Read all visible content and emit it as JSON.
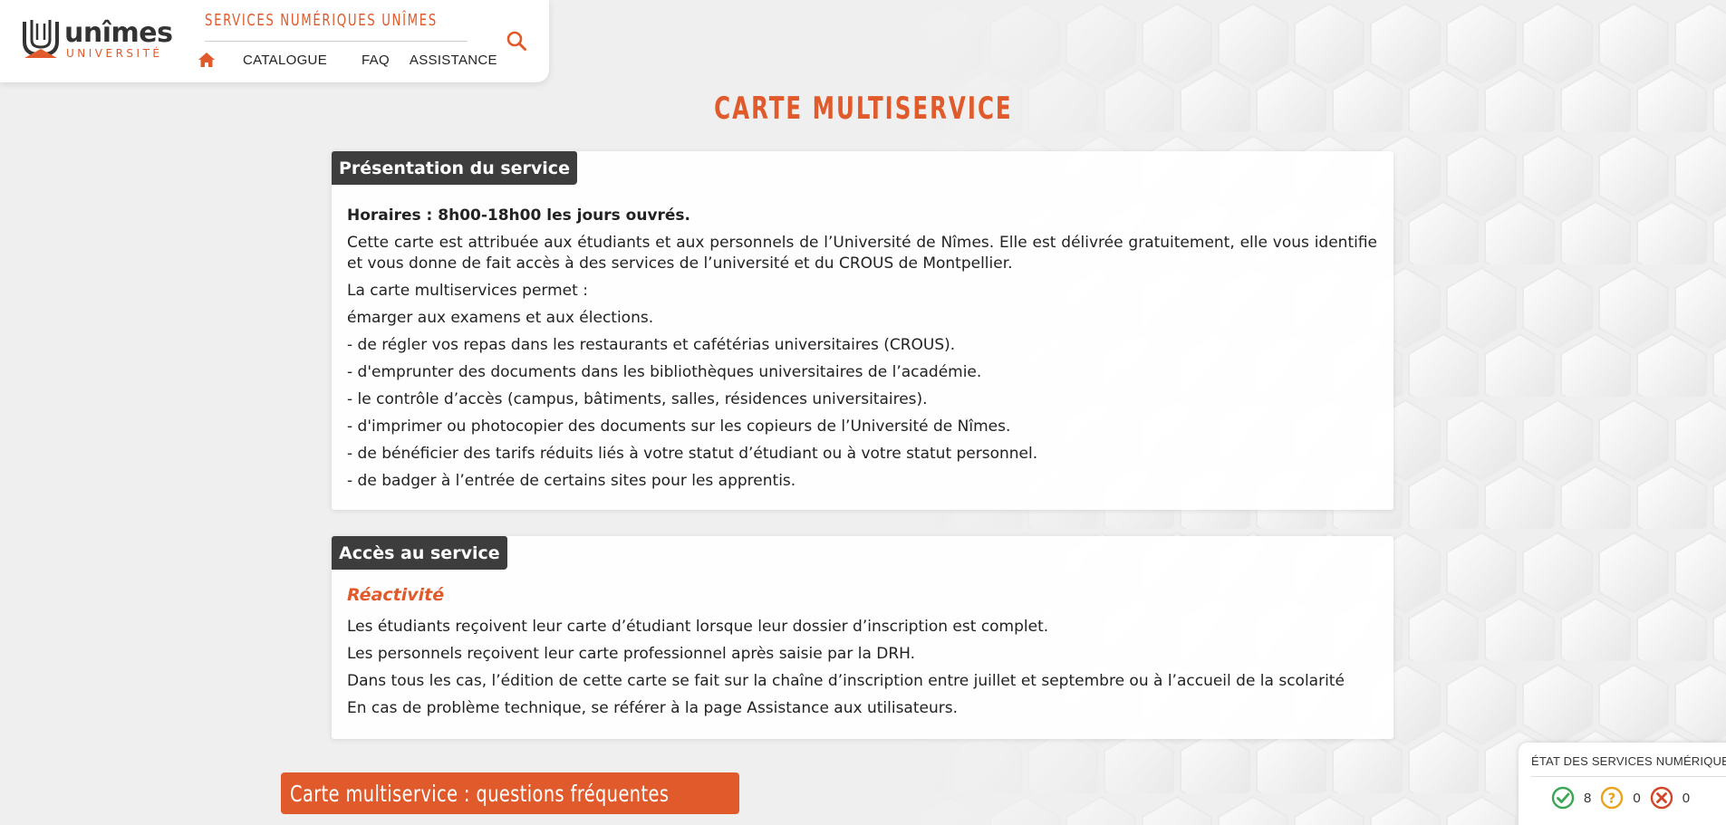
{
  "brand": {
    "logo_name": "unîmes",
    "logo_sub": "UNIVERSITÉ",
    "site_title": "SERVICES NUMÉRIQUES UNÎMES",
    "accent": "#e05a2b",
    "dark": "#3d3d3d"
  },
  "nav": {
    "home_icon": "home-icon",
    "items": [
      "CATALOGUE",
      "FAQ",
      "ASSISTANCE"
    ],
    "search_icon": "search-icon"
  },
  "page": {
    "title": "CARTE MULTISERVICE"
  },
  "presentation": {
    "tab": "Présentation du service",
    "hours": "Horaires : 8h00-18h00 les jours ouvrés.",
    "paragraphs": [
      "Cette carte est attribuée aux étudiants et aux personnels de l’Université de Nîmes. Elle est délivrée gratuitement, elle vous identifie et vous donne de fait accès à des services de l’université et du CROUS de Montpellier.",
      "La carte multiservices permet :",
      "émarger aux examens et aux élections.",
      "- de régler vos repas dans les restaurants et cafétérias universitaires (CROUS).",
      "- d'emprunter des documents dans les bibliothèques universitaires de l’académie.",
      "- le contrôle d’accès (campus, bâtiments, salles, résidences universitaires).",
      "- d'imprimer ou photocopier des documents sur les copieurs de l’Université de Nîmes.",
      "- de bénéficier des tarifs réduits liés à votre statut d’étudiant ou à votre statut personnel.",
      "- de badger à l’entrée de certains sites pour les apprentis."
    ]
  },
  "access": {
    "tab": "Accès au service",
    "subhead": "Réactivité",
    "paragraphs": [
      "Les étudiants reçoivent leur carte d’étudiant lorsque leur dossier d’inscription est complet.",
      "Les personnels reçoivent leur carte professionnel après saisie par la DRH.",
      "Dans tous les cas, l’édition de cette carte se fait sur la chaîne d’inscription entre juillet et septembre ou à l’accueil de la scolarité",
      "En cas de problème technique, se référer à la page Assistance aux utilisateurs."
    ]
  },
  "faq_button": {
    "label": "Carte multiservice : questions fréquentes"
  },
  "status": {
    "title": "ÉTAT DES SERVICES NUMÉRIQUES",
    "ok_count": "8",
    "warn_count": "0",
    "error_count": "0",
    "ok_color": "#3aa655",
    "warn_color": "#e8a31f",
    "error_color": "#d2452b"
  }
}
